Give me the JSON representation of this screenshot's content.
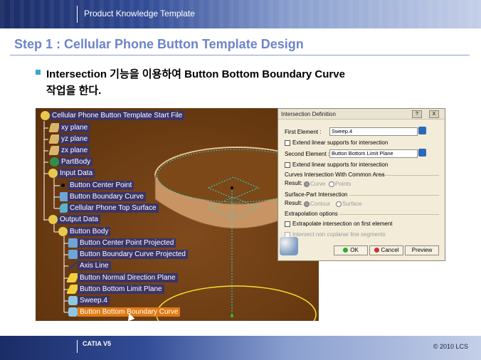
{
  "header": {
    "title": "Product Knowledge Template"
  },
  "slide": {
    "title": "Step 1 : Cellular Phone Button Template Design",
    "bullet_line1": "Intersection 기능을 이용하여 Button Bottom Boundary Curve",
    "bullet_line2": "작업을 한다."
  },
  "tree": {
    "nodes": [
      {
        "label": "Cellular Phone Button Template Start File",
        "icon": "gear-icon"
      },
      {
        "label": "xy plane",
        "icon": "plane-icon"
      },
      {
        "label": "yz plane",
        "icon": "plane-icon"
      },
      {
        "label": "zx plane",
        "icon": "plane-icon"
      },
      {
        "label": "PartBody",
        "icon": "partbody-icon"
      },
      {
        "label": "Input Data",
        "icon": "gear-icon"
      },
      {
        "label": "Button Center Point",
        "icon": "point-icon"
      },
      {
        "label": "Button Boundary Curve",
        "icon": "curve-icon"
      },
      {
        "label": "Cellular Phone Top Surface",
        "icon": "surface-icon"
      },
      {
        "label": "Output Data",
        "icon": "gear-icon"
      },
      {
        "label": "Button Body",
        "icon": "gear-icon"
      },
      {
        "label": "Button Center Point Projected",
        "icon": "projection-icon"
      },
      {
        "label": "Button Boundary Curve Projected",
        "icon": "projection-icon"
      },
      {
        "label": "Axis Line",
        "icon": "line-icon"
      },
      {
        "label": "Button Normal Direction Plane",
        "icon": "plane-icon"
      },
      {
        "label": "Button Bottom Limit Plane",
        "icon": "plane-icon"
      },
      {
        "label": "Sweep.4",
        "icon": "sweep-icon"
      },
      {
        "label": "Button Bottom Boundary Curve",
        "icon": "intersection-icon",
        "selected": true
      }
    ]
  },
  "dialog": {
    "title": "Intersection Definition",
    "help_button": "?",
    "close_button": "X",
    "first_element_label": "First Element :",
    "first_element_value": "Sweep.4",
    "extend_first": "Extend linear supports for intersection",
    "second_element_label": "Second Element :",
    "second_element_value": "Button Bottom Limit Plane",
    "extend_second": "Extend linear supports for intersection",
    "curves_section": "Curves Intersection With Common Area",
    "result_label": "Result:",
    "curve_option": "Curve",
    "points_option": "Points",
    "surface_section": "Surface-Part Intersection",
    "result_label2": "Result:",
    "contour_option": "Contour",
    "surface_option": "Surface",
    "extrapolation_section": "Extrapolation options",
    "extrapolate_first": "Extrapolate intersection on first element",
    "intersect_noncoplanar": "Intersect non coplanar line segments",
    "ok": "OK",
    "cancel": "Cancel",
    "preview": "Preview"
  },
  "footer": {
    "brand": "CATIA V5",
    "copyright": "© 2010 LCS"
  },
  "colors": {
    "header_start": "#1b2c66",
    "title": "#6d84c8",
    "tree_node_bg": "#3b3468",
    "tree_selected_bg": "#e07a12",
    "canvas_bg": "#6f3f14",
    "dialog_bg": "#f3ecd9"
  }
}
